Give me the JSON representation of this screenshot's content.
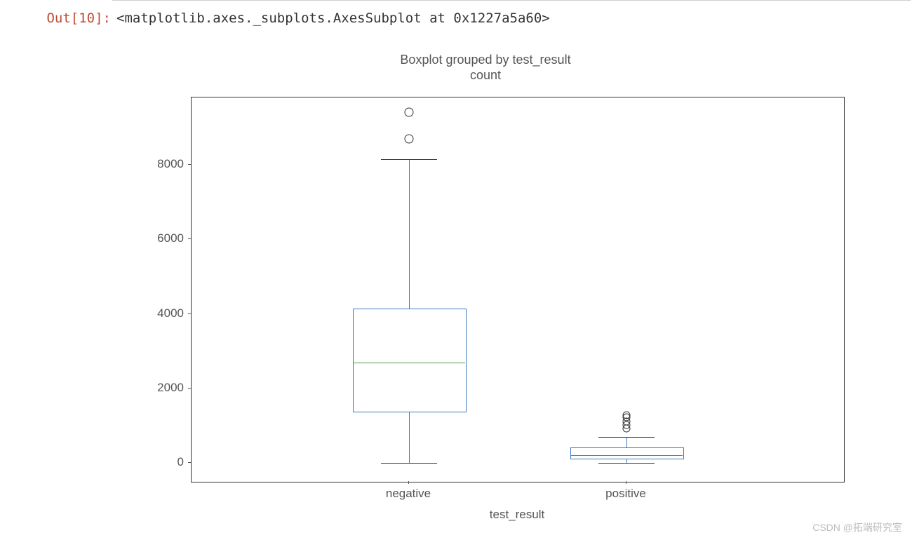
{
  "cell": {
    "out_label": "Out[10]:",
    "out_text": "<matplotlib.axes._subplots.AxesSubplot at 0x1227a5a60>"
  },
  "watermark": "CSDN @拓端研究室",
  "chart_data": {
    "type": "boxplot",
    "suptitle": "Boxplot grouped by test_result",
    "title": "count",
    "xlabel": "test_result",
    "ylabel": "",
    "categories": [
      "negative",
      "positive"
    ],
    "yticks": [
      0,
      2000,
      4000,
      6000,
      8000
    ],
    "ylim": [
      -500,
      9800
    ],
    "boxes": [
      {
        "category": "negative",
        "q1": 1400,
        "median": 2700,
        "q3": 4150,
        "whisker_lo": 0,
        "whisker_hi": 8150,
        "fliers": [
          8700,
          9400
        ]
      },
      {
        "category": "positive",
        "q1": 130,
        "median": 220,
        "q3": 420,
        "whisker_lo": 0,
        "whisker_hi": 700,
        "fliers": [
          920,
          1020,
          1120,
          1220,
          1280
        ]
      }
    ]
  }
}
